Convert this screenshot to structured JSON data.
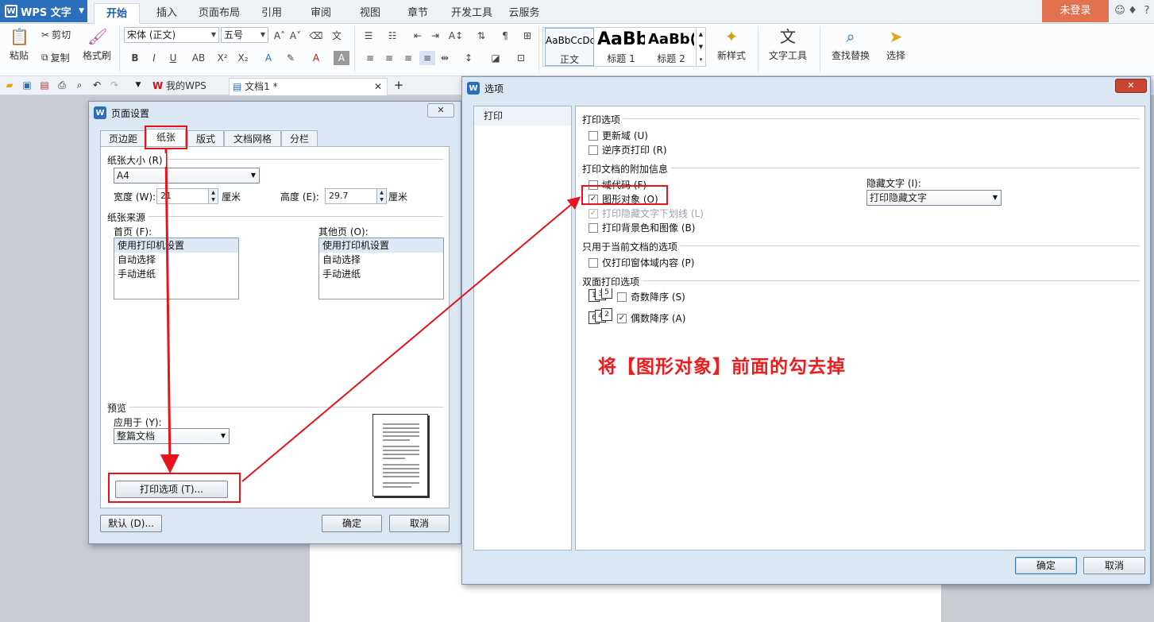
{
  "app": {
    "name": "WPS 文字",
    "login": "未登录"
  },
  "ribbon_tabs": [
    "开始",
    "插入",
    "页面布局",
    "引用",
    "审阅",
    "视图",
    "章节",
    "开发工具",
    "云服务"
  ],
  "ribbon": {
    "paste": "粘贴",
    "cut": "剪切",
    "copy": "复制",
    "format_painter": "格式刷",
    "font_name": "宋体 (正文)",
    "font_size": "五号",
    "styles": [
      {
        "sample": "AaBbCcDd",
        "name": "正文"
      },
      {
        "sample": "AaBb",
        "name": "标题 1"
      },
      {
        "sample": "AaBb(",
        "name": "标题 2"
      }
    ],
    "new_style": "新样式",
    "text_tools": "文字工具",
    "find_replace": "查找替换",
    "select": "选择"
  },
  "doc_tabs": {
    "home": "我的WPS",
    "doc": "文档1 *"
  },
  "page_setup": {
    "title": "页面设置",
    "tabs": [
      "页边距",
      "纸张",
      "版式",
      "文档网格",
      "分栏"
    ],
    "paper_size_group": "纸张大小 (R)",
    "paper_size": "A4",
    "width_label": "宽度 (W):",
    "width_value": "21",
    "height_label": "高度 (E):",
    "height_value": "29.7",
    "unit": "厘米",
    "paper_source_group": "纸张来源",
    "first_page_label": "首页 (F):",
    "other_pages_label": "其他页 (O):",
    "source_items": [
      "使用打印机设置",
      "自动选择",
      "手动进纸"
    ],
    "preview_group": "预览",
    "apply_to_label": "应用于 (Y):",
    "apply_to": "整篇文档",
    "print_options_button": "打印选项 (T)...",
    "default_button": "默认 (D)...",
    "ok": "确定",
    "cancel": "取消"
  },
  "options": {
    "title": "选项",
    "nav": [
      "打印"
    ],
    "print_options_group": "打印选项",
    "update_fields": "更新域 (U)",
    "reverse_order": "逆序页打印 (R)",
    "extra_info_group": "打印文档的附加信息",
    "field_codes": "域代码 (F)",
    "drawing_objects": "图形对象 (O)",
    "hidden_text_underline": "打印隐藏文字下划线 (L)",
    "background": "打印背景色和图像 (B)",
    "hidden_text_label": "隐藏文字 (I):",
    "hidden_text_value": "打印隐藏文字",
    "current_doc_group": "只用于当前文档的选项",
    "form_data_only": "仅打印窗体域内容 (P)",
    "duplex_group": "双面打印选项",
    "odd_reverse": "奇数降序 (S)",
    "even_reverse": "偶数降序 (A)",
    "ok": "确定",
    "cancel": "取消"
  },
  "annotation": "将【图形对象】前面的勾去掉",
  "colors": {
    "accent": "#2a6ebc",
    "annotation": "#ee1c1c",
    "login": "#e2714f"
  }
}
